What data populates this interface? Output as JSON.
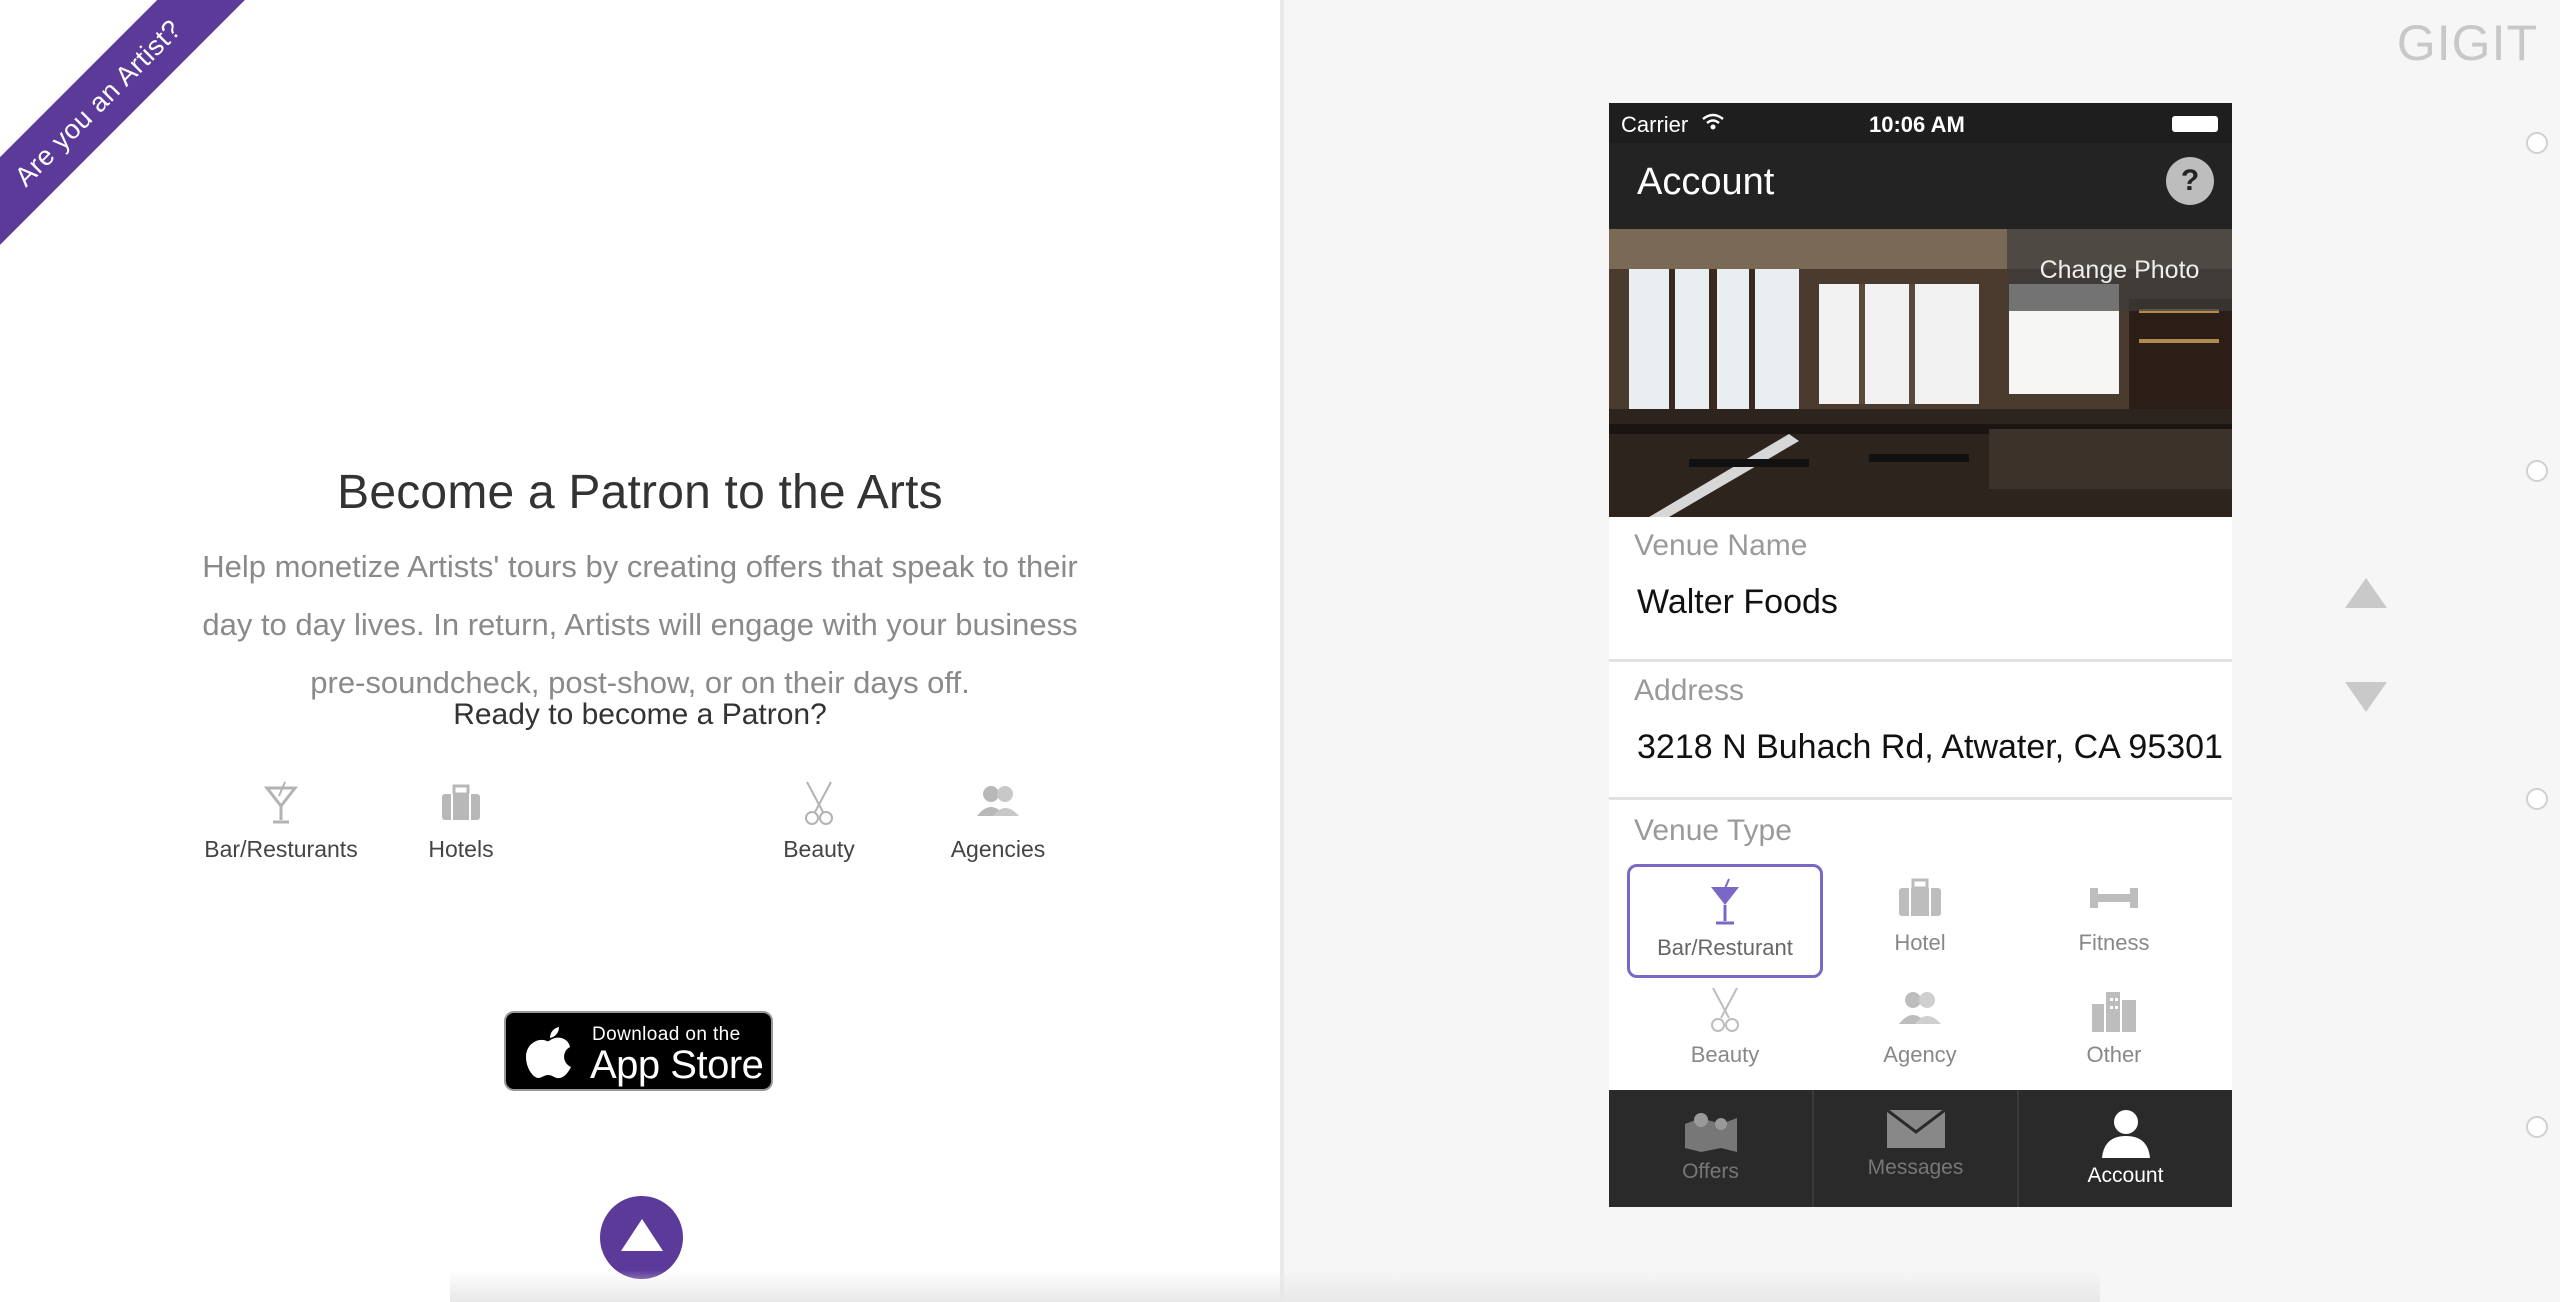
{
  "banner": {
    "label": "Are you an Artist?"
  },
  "hero": {
    "title": "Become a Patron to the Arts",
    "description": "Help monetize Artists' tours by creating offers that speak to their day to day lives. In return, Artists will engage with your business pre-soundcheck, post-show, or on their days off.",
    "cta": "Ready to become a Patron?"
  },
  "categories": [
    {
      "label": "Bar/Resturants",
      "icon": "cocktail-icon"
    },
    {
      "label": "Hotels",
      "icon": "suitcase-icon"
    },
    {
      "label": "Beauty",
      "icon": "scissors-icon"
    },
    {
      "label": "Agencies",
      "icon": "people-icon"
    }
  ],
  "app_store": {
    "small": "Download on the",
    "big": "App Store"
  },
  "brand": "GIGIT",
  "phone": {
    "status": {
      "carrier": "Carrier",
      "time": "10:06 AM"
    },
    "nav": {
      "title": "Account",
      "help": "?"
    },
    "photo": {
      "change_label": "Change Photo"
    },
    "venue_name": {
      "label": "Venue Name",
      "value": "Walter Foods"
    },
    "address": {
      "label": "Address",
      "value": "3218 N Buhach Rd, Atwater, CA 95301"
    },
    "venue_type": {
      "label": "Venue Type",
      "options": [
        {
          "label": "Bar/Resturant",
          "selected": true
        },
        {
          "label": "Hotel",
          "selected": false
        },
        {
          "label": "Fitness",
          "selected": false
        },
        {
          "label": "Beauty",
          "selected": false
        },
        {
          "label": "Agency",
          "selected": false
        },
        {
          "label": "Other",
          "selected": false
        }
      ]
    },
    "tabs": [
      {
        "label": "Offers",
        "active": false
      },
      {
        "label": "Messages",
        "active": false
      },
      {
        "label": "Account",
        "active": true
      }
    ]
  },
  "colors": {
    "accent": "#5b3a9a",
    "selection": "#7b68c6"
  }
}
